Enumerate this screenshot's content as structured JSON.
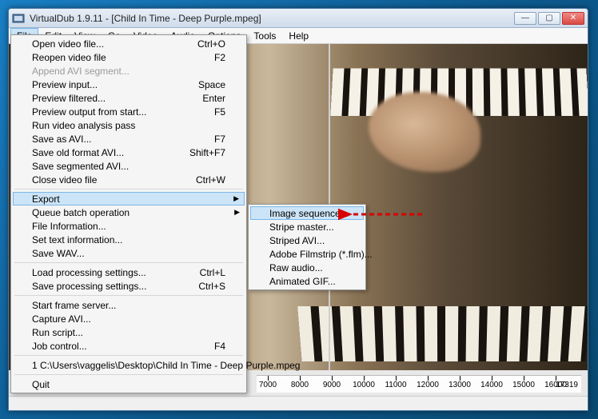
{
  "window": {
    "title": "VirtualDub 1.9.11 - [Child In Time - Deep Purple.mpeg]"
  },
  "menubar": [
    "File",
    "Edit",
    "View",
    "Go",
    "Video",
    "Audio",
    "Options",
    "Tools",
    "Help"
  ],
  "file_menu": {
    "groups": [
      [
        {
          "label": "Open video file...",
          "shortcut": "Ctrl+O"
        },
        {
          "label": "Reopen video file",
          "shortcut": "F2"
        },
        {
          "label": "Append AVI segment...",
          "disabled": true
        },
        {
          "label": "Preview input...",
          "shortcut": "Space"
        },
        {
          "label": "Preview filtered...",
          "shortcut": "Enter"
        },
        {
          "label": "Preview output from start...",
          "shortcut": "F5"
        },
        {
          "label": "Run video analysis pass"
        },
        {
          "label": "Save as AVI...",
          "shortcut": "F7"
        },
        {
          "label": "Save old format AVI...",
          "shortcut": "Shift+F7"
        },
        {
          "label": "Save segmented AVI..."
        },
        {
          "label": "Close video file",
          "shortcut": "Ctrl+W"
        }
      ],
      [
        {
          "label": "Export",
          "submenu": true,
          "highlight": true
        },
        {
          "label": "Queue batch operation",
          "submenu": true
        },
        {
          "label": "File Information..."
        },
        {
          "label": "Set text information..."
        },
        {
          "label": "Save WAV..."
        }
      ],
      [
        {
          "label": "Load processing settings...",
          "shortcut": "Ctrl+L"
        },
        {
          "label": "Save processing settings...",
          "shortcut": "Ctrl+S"
        }
      ],
      [
        {
          "label": "Start frame server..."
        },
        {
          "label": "Capture AVI..."
        },
        {
          "label": "Run script..."
        },
        {
          "label": "Job control...",
          "shortcut": "F4"
        }
      ],
      [
        {
          "label": "1 C:\\Users\\vaggelis\\Desktop\\Child In Time - Deep Purple.mpeg"
        }
      ],
      [
        {
          "label": "Quit"
        }
      ]
    ]
  },
  "export_menu": [
    {
      "label": "Image sequence...",
      "highlight": true
    },
    {
      "label": "Stripe master..."
    },
    {
      "label": "Striped AVI..."
    },
    {
      "label": "Adobe Filmstrip (*.flm)..."
    },
    {
      "label": "Raw audio..."
    },
    {
      "label": "Animated GIF..."
    }
  ],
  "timeline": {
    "ticks": [
      "7000",
      "8000",
      "9000",
      "10000",
      "11000",
      "12000",
      "13000",
      "14000",
      "15000",
      "16000"
    ],
    "end": "17319"
  }
}
